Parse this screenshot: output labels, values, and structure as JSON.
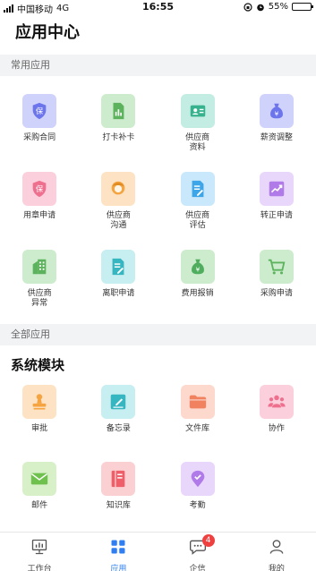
{
  "status_bar": {
    "carrier": "中国移动",
    "network": "4G",
    "time": "16:55",
    "battery_text": "55%",
    "battery_level": 0.55
  },
  "page_title": "应用中心",
  "sections": {
    "common": "常用应用",
    "all": "全部应用",
    "system_module": "系统模块"
  },
  "common_apps": [
    {
      "label": "采购合同",
      "icon": "shield-bao-icon",
      "bg": "#cfd3fb",
      "fg": "#6d75ec"
    },
    {
      "label": "打卡补卡",
      "icon": "doc-chart-icon",
      "bg": "#cdeccd",
      "fg": "#5db35d"
    },
    {
      "label": "供应商\n资料",
      "icon": "id-card-icon",
      "bg": "#c3ece2",
      "fg": "#36b38e"
    },
    {
      "label": "薪资调整",
      "icon": "money-bag-icon",
      "bg": "#cfd3fb",
      "fg": "#6d75ec"
    },
    {
      "label": "用章申请",
      "icon": "shield-bao-icon",
      "bg": "#fbd0dc",
      "fg": "#ef6f8f"
    },
    {
      "label": "供应商\n沟通",
      "icon": "person-icon",
      "bg": "#fde3c4",
      "fg": "#f5a441"
    },
    {
      "label": "供应商\n评估",
      "icon": "doc-edit-icon",
      "bg": "#c9e8fb",
      "fg": "#3da6e8"
    },
    {
      "label": "转正申请",
      "icon": "chart-up-icon",
      "bg": "#e8d6fb",
      "fg": "#b07ae9"
    },
    {
      "label": "供应商\n异常",
      "icon": "building-icon",
      "bg": "#cdeccd",
      "fg": "#5db35d"
    },
    {
      "label": "离职申请",
      "icon": "doc-edit-icon",
      "bg": "#c7eef0",
      "fg": "#35b6c1"
    },
    {
      "label": "费用报销",
      "icon": "money-bag-icon",
      "bg": "#cdeccd",
      "fg": "#4fae5d"
    },
    {
      "label": "采购申请",
      "icon": "cart-icon",
      "bg": "#cdeccd",
      "fg": "#5db35d"
    }
  ],
  "system_apps": [
    {
      "label": "审批",
      "icon": "stamp-icon",
      "bg": "#fde3c4",
      "fg": "#f5a441"
    },
    {
      "label": "备忘录",
      "icon": "note-edit-icon",
      "bg": "#c7eef0",
      "fg": "#35b6c1"
    },
    {
      "label": "文件库",
      "icon": "folder-icon",
      "bg": "#fdd8cc",
      "fg": "#f0825f"
    },
    {
      "label": "协作",
      "icon": "team-icon",
      "bg": "#fbd0dc",
      "fg": "#ef6f8f"
    },
    {
      "label": "邮件",
      "icon": "mail-icon",
      "bg": "#d7f0c8",
      "fg": "#6ec14d"
    },
    {
      "label": "知识库",
      "icon": "book-icon",
      "bg": "#fbd0d2",
      "fg": "#ef5f6a"
    },
    {
      "label": "考勤",
      "icon": "location-check-icon",
      "bg": "#e8d6fb",
      "fg": "#b07ae9"
    }
  ],
  "tabbar": [
    {
      "label": "工作台",
      "icon": "workbench-icon",
      "active": false
    },
    {
      "label": "应用",
      "icon": "apps-grid-icon",
      "active": true
    },
    {
      "label": "企信",
      "icon": "chat-bubble-icon",
      "active": false,
      "badge": "4"
    },
    {
      "label": "我的",
      "icon": "user-icon",
      "active": false
    }
  ],
  "colors": {
    "accent": "#2f7ff3",
    "badge": "#ef4040",
    "section_bg": "#f2f3f5"
  }
}
